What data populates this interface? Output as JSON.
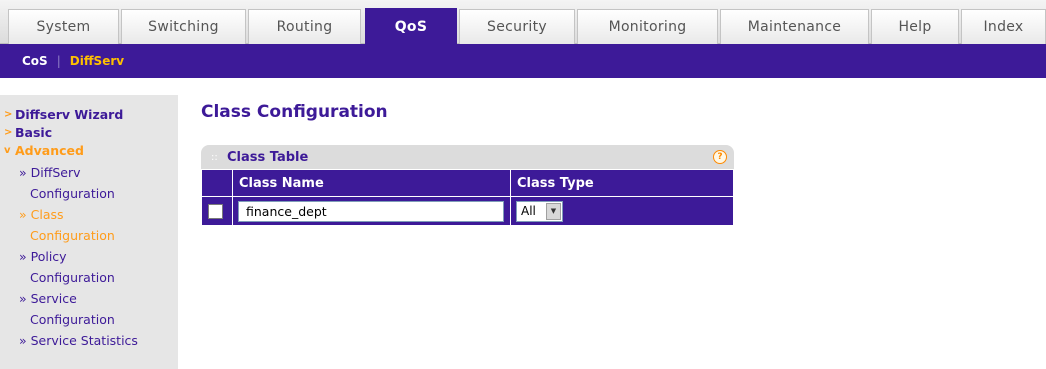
{
  "nav": {
    "tabs": [
      "System",
      "Switching",
      "Routing",
      "QoS",
      "Security",
      "Monitoring",
      "Maintenance",
      "Help",
      "Index"
    ],
    "active_tab": "QoS"
  },
  "subnav": {
    "items": [
      "CoS",
      "DiffServ"
    ],
    "separator": "|",
    "active": "DiffServ"
  },
  "sidebar": {
    "sections": [
      {
        "label": "Diffserv Wizard",
        "arrow": ">"
      },
      {
        "label": "Basic",
        "arrow": ">"
      },
      {
        "label": "Advanced",
        "arrow": "v"
      }
    ],
    "sub_items": [
      {
        "line1": "» DiffServ",
        "line2": "Configuration"
      },
      {
        "line1": "» Class",
        "line2": "Configuration"
      },
      {
        "line1": "» Policy",
        "line2": "Configuration"
      },
      {
        "line1": "» Service",
        "line2": "Configuration"
      },
      {
        "line1": "» Service Statistics",
        "line2": ""
      }
    ],
    "active_sub": "» Class"
  },
  "main": {
    "page_title": "Class Configuration",
    "panel_title": "Class Table",
    "help_icon": "?",
    "grip_icon": "::",
    "columns": [
      "Class Name",
      "Class Type"
    ],
    "row": {
      "class_name": "finance_dept",
      "class_type": "All",
      "dropdown_arrow": "▼"
    }
  },
  "colors": {
    "brand": "#3d1a98",
    "accent": "#ff9c1a",
    "subnav_active": "#ffc000"
  }
}
